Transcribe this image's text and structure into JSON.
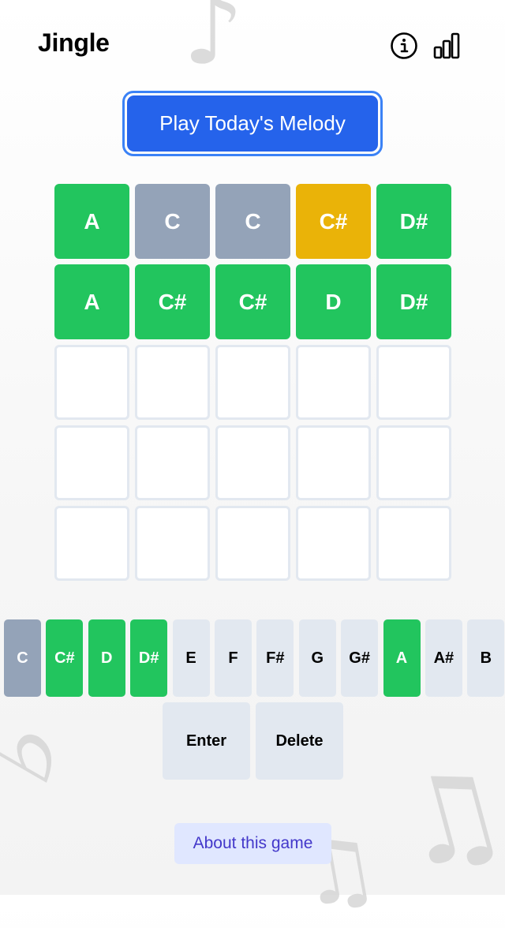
{
  "app": {
    "title": "Jingle"
  },
  "header": {
    "info_icon": "info-icon",
    "stats_icon": "stats-icon"
  },
  "play_button": {
    "label": "Play Today's Melody",
    "color": "#2563eb"
  },
  "colors": {
    "correct": "#22c55e",
    "present": "#eab308",
    "absent": "#94a3b8",
    "empty_border": "#e2e8f0",
    "key_default": "#e2e8f0"
  },
  "board": {
    "rows": [
      [
        {
          "note": "A",
          "state": "correct"
        },
        {
          "note": "C",
          "state": "absent"
        },
        {
          "note": "C",
          "state": "absent"
        },
        {
          "note": "C#",
          "state": "present"
        },
        {
          "note": "D#",
          "state": "correct"
        }
      ],
      [
        {
          "note": "A",
          "state": "correct"
        },
        {
          "note": "C#",
          "state": "correct"
        },
        {
          "note": "C#",
          "state": "correct"
        },
        {
          "note": "D",
          "state": "correct"
        },
        {
          "note": "D#",
          "state": "correct"
        }
      ],
      [
        {
          "note": "",
          "state": "empty"
        },
        {
          "note": "",
          "state": "empty"
        },
        {
          "note": "",
          "state": "empty"
        },
        {
          "note": "",
          "state": "empty"
        },
        {
          "note": "",
          "state": "empty"
        }
      ],
      [
        {
          "note": "",
          "state": "empty"
        },
        {
          "note": "",
          "state": "empty"
        },
        {
          "note": "",
          "state": "empty"
        },
        {
          "note": "",
          "state": "empty"
        },
        {
          "note": "",
          "state": "empty"
        }
      ],
      [
        {
          "note": "",
          "state": "empty"
        },
        {
          "note": "",
          "state": "empty"
        },
        {
          "note": "",
          "state": "empty"
        },
        {
          "note": "",
          "state": "empty"
        },
        {
          "note": "",
          "state": "empty"
        }
      ]
    ]
  },
  "keyboard": {
    "keys": [
      {
        "label": "C",
        "state": "absent"
      },
      {
        "label": "C#",
        "state": "correct"
      },
      {
        "label": "D",
        "state": "correct"
      },
      {
        "label": "D#",
        "state": "correct"
      },
      {
        "label": "E",
        "state": "default"
      },
      {
        "label": "F",
        "state": "default"
      },
      {
        "label": "F#",
        "state": "default"
      },
      {
        "label": "G",
        "state": "default"
      },
      {
        "label": "G#",
        "state": "default"
      },
      {
        "label": "A",
        "state": "correct"
      },
      {
        "label": "A#",
        "state": "default"
      },
      {
        "label": "B",
        "state": "default"
      }
    ],
    "enter_label": "Enter",
    "delete_label": "Delete"
  },
  "footer": {
    "about_label": "About this game"
  },
  "background_decor": [
    "music-note-icon",
    "flat-icon",
    "beamed-notes-icon"
  ]
}
